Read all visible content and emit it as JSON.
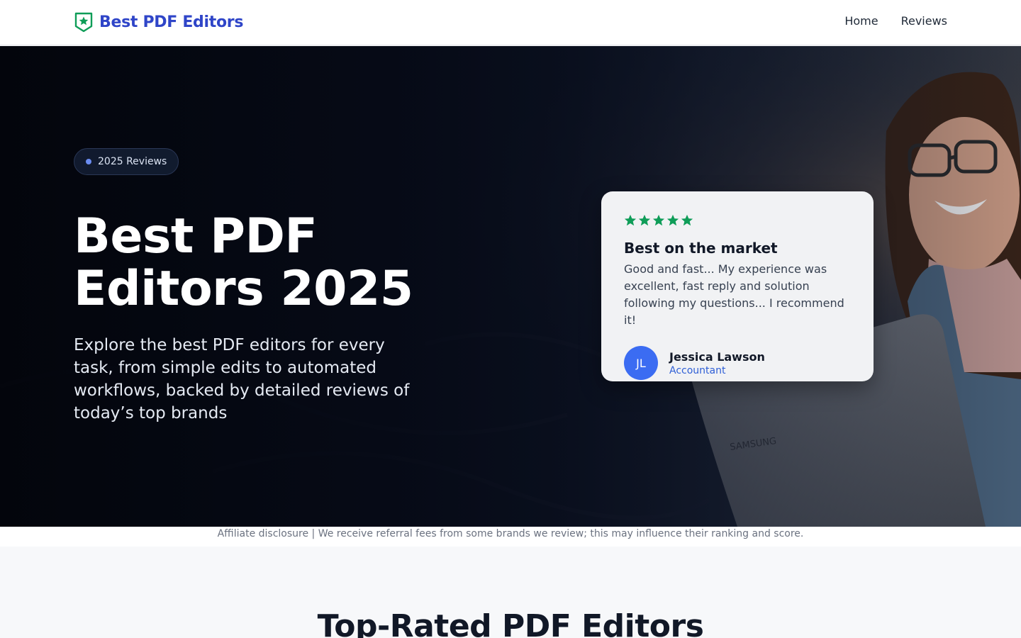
{
  "header": {
    "logo_text": "Best PDF Editors",
    "nav": [
      {
        "label": "Home"
      },
      {
        "label": "Reviews"
      }
    ]
  },
  "hero": {
    "badge": "2025 Reviews",
    "title_line1": "Best PDF",
    "title_line2": "Editors 2025",
    "subtitle": "Explore the best PDF editors for every task, from simple edits to automated workflows, backed by detailed reviews of today’s top brands",
    "review": {
      "rating": 5,
      "title": "Best on the market",
      "text": "Good and fast... My experience was excellent, fast reply and solution following my questions... I recommend it!",
      "author_initials": "JL",
      "author_name": "Jessica Lawson",
      "author_role": "Accountant"
    }
  },
  "disclosure": "Affiliate disclosure | We receive referral fees from some brands we review; this may influence their ranking and score.",
  "section": {
    "title": "Top-Rated PDF Editors"
  },
  "colors": {
    "brand": "#2f45c8",
    "logo_green": "#0f9d58",
    "star_green": "#0f9d58",
    "avatar_blue": "#3b6cf2",
    "hero_dark": "#0a0f1c"
  },
  "icons": {
    "logo": "shield-star-icon",
    "badge_dot": "dot-icon",
    "star": "star-icon"
  }
}
